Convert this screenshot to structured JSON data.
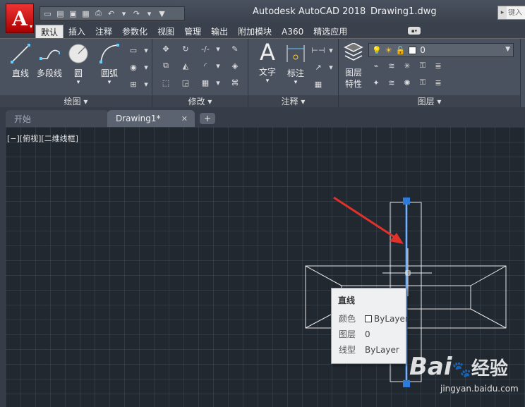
{
  "window": {
    "app_title": "Autodesk AutoCAD 2018",
    "doc_title": "Drawing1.dwg",
    "search_placeholder": "键入"
  },
  "app_logo": "A",
  "ribbon_tabs": [
    "默认",
    "插入",
    "注释",
    "参数化",
    "视图",
    "管理",
    "输出",
    "附加模块",
    "A360",
    "精选应用"
  ],
  "ribbon_groups": {
    "draw": {
      "title": "绘图",
      "line": "直线",
      "polyline": "多段线",
      "circle": "圆",
      "arc": "圆弧"
    },
    "modify": {
      "title": "修改"
    },
    "annotation": {
      "title": "注释",
      "text": "文字",
      "dimension": "标注"
    },
    "layers": {
      "title": "图层",
      "properties": "图层\n特性",
      "properties_line1": "图层",
      "properties_line2": "特性",
      "current_layer": "0"
    }
  },
  "doc_tabs": {
    "start": "开始",
    "drawing": "Drawing1*",
    "close": "✕",
    "plus": "+"
  },
  "viewport_label": "[−][俯视][二维线框]",
  "tooltip": {
    "title": "直线",
    "rows": [
      {
        "key": "颜色",
        "value": "ByLayer"
      },
      {
        "key": "图层",
        "value": "0"
      },
      {
        "key": "线型",
        "value": "ByLayer"
      }
    ]
  },
  "watermark": {
    "brand": "Bai",
    "brand2": "经验",
    "url": "jingyan.baidu.com"
  },
  "colors": {
    "canvas_bg": "#212830",
    "selection_blue": "#2f7bd9",
    "arrow_red": "#e0312a",
    "logo_red": "#cc1b1b"
  }
}
